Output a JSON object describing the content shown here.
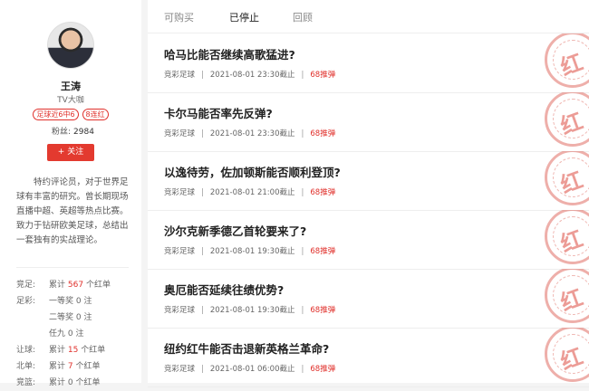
{
  "profile": {
    "name": "王涛",
    "subtitle": "TV大咖",
    "badges": [
      "足球近6中6",
      "8连红"
    ],
    "fans_label": "粉丝:",
    "fans_count": "2984",
    "follow_label": "+ 关注",
    "bio": "特约评论员，对于世界足球有丰富的研究。曾长期现场直播中超、英超等热点比赛。致力于钻研欧美足球，总结出一套独有的实战理论。",
    "stats": [
      {
        "label": "竞足:",
        "prefix": "累计",
        "value": "567",
        "suffix": "个红单",
        "highlight": true
      },
      {
        "label": "足彩:",
        "prefix": "一等奖",
        "value": "0",
        "suffix": "注",
        "highlight": false
      },
      {
        "label": "",
        "prefix": "二等奖",
        "value": "0",
        "suffix": "注",
        "highlight": false
      },
      {
        "label": "",
        "prefix": "任九",
        "value": "0",
        "suffix": "注",
        "highlight": false
      },
      {
        "label": "让球:",
        "prefix": "累计",
        "value": "15",
        "suffix": "个红单",
        "highlight": true
      },
      {
        "label": "北单:",
        "prefix": "累计",
        "value": "7",
        "suffix": "个红单",
        "highlight": true
      },
      {
        "label": "竞篮:",
        "prefix": "累计",
        "value": "0",
        "suffix": "个红单",
        "highlight": false
      }
    ]
  },
  "tabs": [
    "可购买",
    "已停止",
    "回顾"
  ],
  "active_tab": "已停止",
  "articles": [
    {
      "title": "哈马比能否继续高歌猛进?",
      "category": "竞彩足球",
      "deadline": "2021-08-01 23:30截止",
      "price": "68推弹",
      "stamp": "红"
    },
    {
      "title": "卡尔马能否率先反弹?",
      "category": "竞彩足球",
      "deadline": "2021-08-01 23:30截止",
      "price": "68推弹",
      "stamp": "红"
    },
    {
      "title": "以逸待劳，佐加顿斯能否顺利登顶?",
      "category": "竞彩足球",
      "deadline": "2021-08-01 21:00截止",
      "price": "68推弹",
      "stamp": "红"
    },
    {
      "title": "沙尔克新季德乙首轮要来了?",
      "category": "竞彩足球",
      "deadline": "2021-08-01 19:30截止",
      "price": "68推弹",
      "stamp": "红"
    },
    {
      "title": "奥厄能否延续往绩优势?",
      "category": "竞彩足球",
      "deadline": "2021-08-01 19:30截止",
      "price": "68推弹",
      "stamp": "红"
    },
    {
      "title": "纽约红牛能否击退新英格兰革命?",
      "category": "竞彩足球",
      "deadline": "2021-08-01 06:00截止",
      "price": "68推弹",
      "stamp": "红"
    }
  ]
}
